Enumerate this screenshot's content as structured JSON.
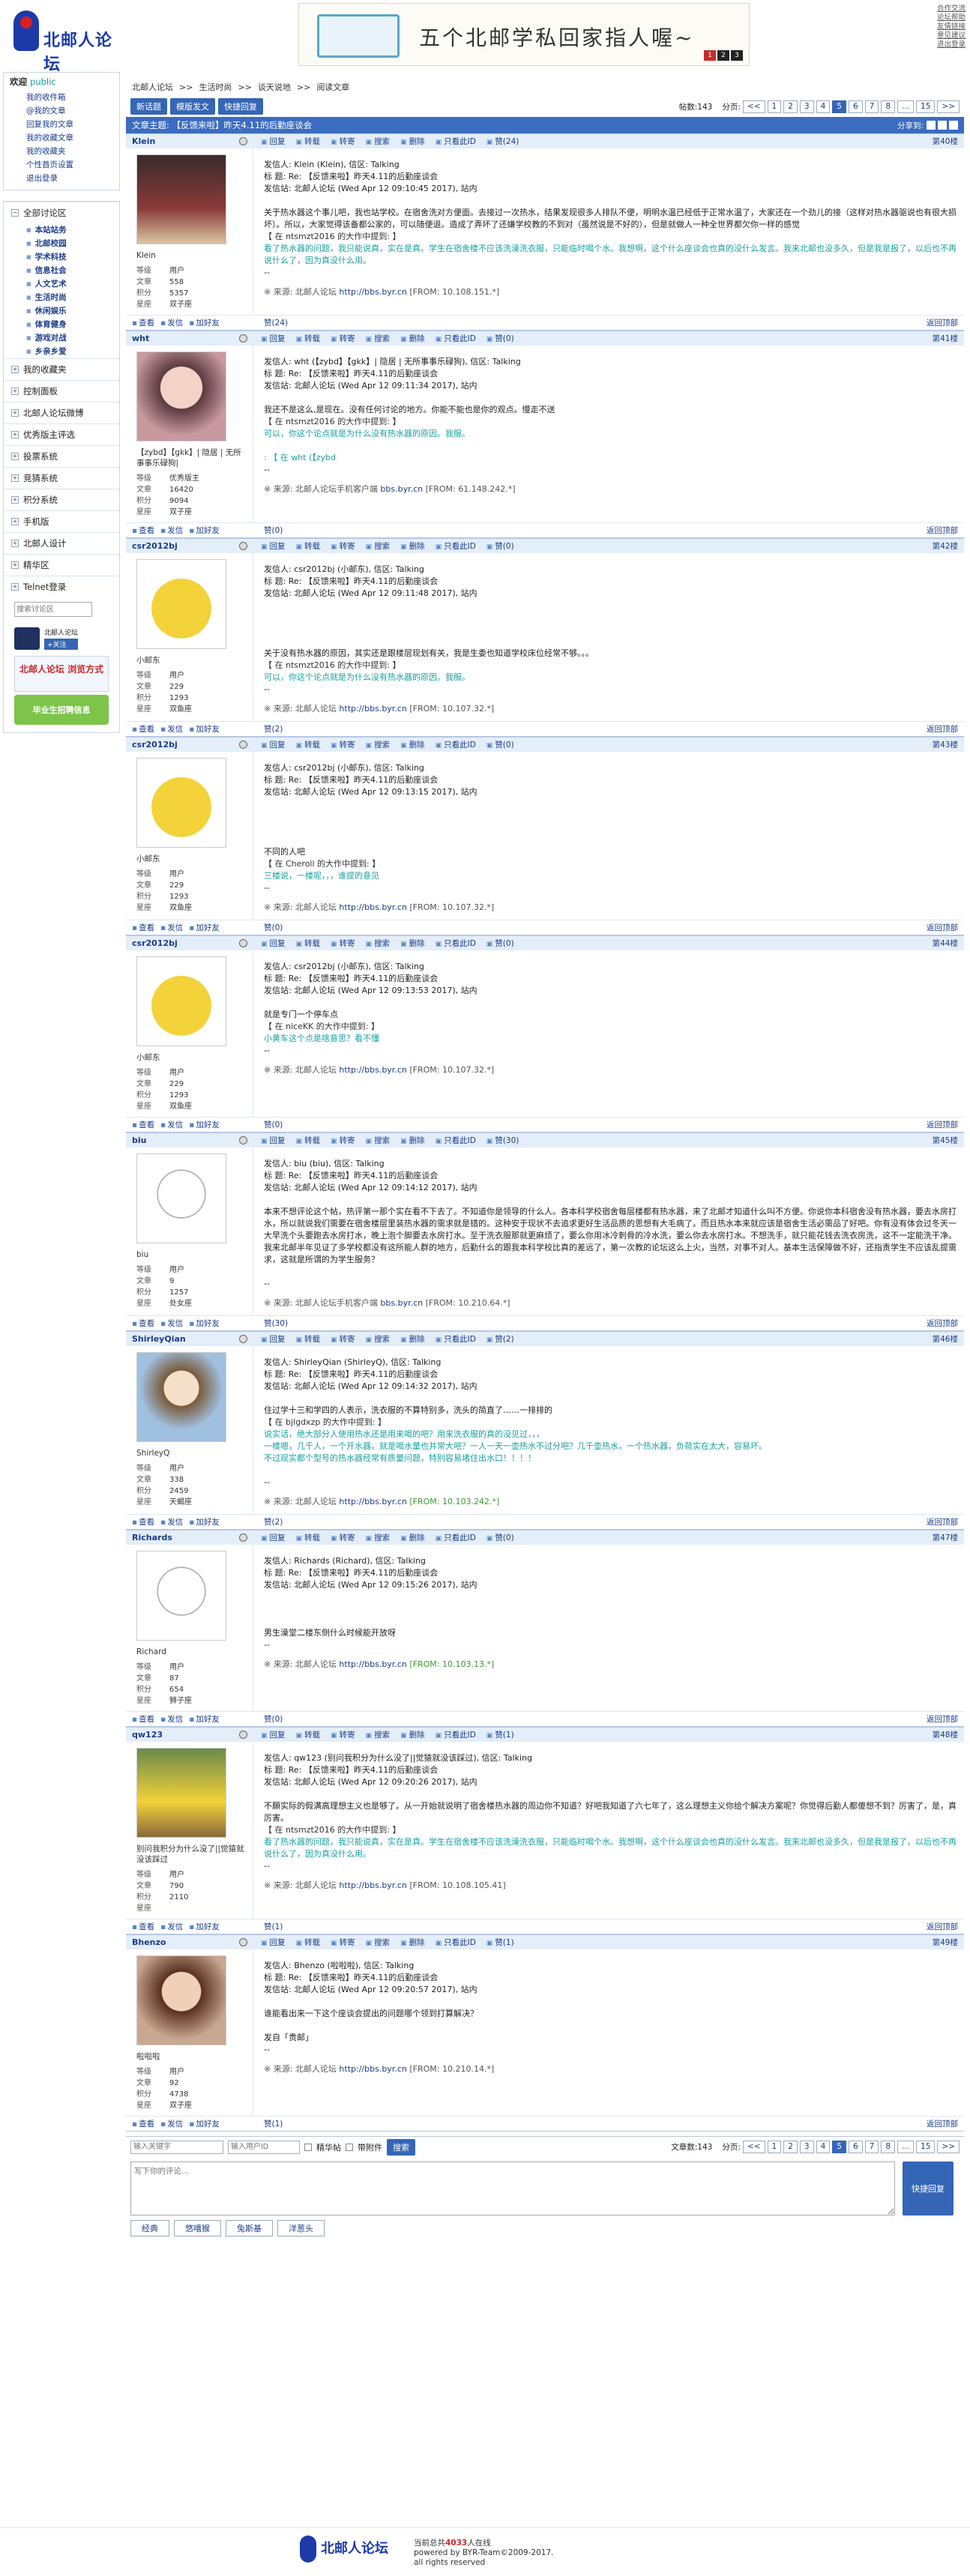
{
  "header": {
    "logo": "北邮人论坛",
    "banner_text": "五个北邮学私回家指人喔~",
    "banner_pages": [
      "1",
      "2",
      "3"
    ],
    "links": [
      "合作交流",
      "论坛帮助",
      "友情链接",
      "意见建议",
      "退出登录"
    ]
  },
  "sidebar": {
    "welcome": "欢迎",
    "pub": "public",
    "my": [
      "我的收件箱",
      "@我的文章",
      "回复我的文章",
      "我的收藏文章",
      "我的收藏夹",
      "个性首页设置",
      "退出登录"
    ],
    "all": "全部讨论区",
    "boards": [
      "本站站务",
      "北邮校园",
      "学术科技",
      "信息社会",
      "人文艺术",
      "生活时尚",
      "休闲娱乐",
      "体育健身",
      "游戏对战",
      "乡亲乡爱"
    ],
    "sections": [
      "我的收藏夹",
      "控制面板",
      "北邮人论坛微博",
      "优秀版主评选",
      "投票系统",
      "竞猜系统",
      "积分系统",
      "手机版",
      "北邮人设计",
      "精华区",
      "Telnet登录"
    ],
    "search_placeholder": "搜索讨论区",
    "weibo": "北邮人论坛",
    "follow": "+关注",
    "promo1": "北邮人论坛 浏览方式",
    "promo2": "毕业生招聘信息"
  },
  "crumb": [
    "北邮人论坛",
    ">>",
    "生活时尚",
    ">>",
    "谈天说地",
    ">>",
    "阅读文章"
  ],
  "toolbar": {
    "new": "新话题",
    "template": "模版发文",
    "reply": "快捷回复",
    "count": "帖数:143",
    "pages_label": "分页:",
    "pages": [
      "<<",
      "1",
      "2",
      "3",
      "4",
      "5",
      "6",
      "7",
      "8",
      "...",
      "15",
      ">>"
    ],
    "cur": "5"
  },
  "topic": {
    "label": "文章主题:",
    "title": "【反馈来啦】昨天4.11的后勤座谈会",
    "share": "分享到:"
  },
  "actions": [
    "回复",
    "转载",
    "转寄",
    "搜索",
    "删除",
    "只看此ID"
  ],
  "foot_actions": [
    "查看",
    "发信",
    "加好友"
  ],
  "back_top": "返回顶部",
  "stat_labels": [
    "等级",
    "文章",
    "积分",
    "星座"
  ],
  "posts": [
    {
      "id": "Klein",
      "floor": "第40楼",
      "like_head": "赞(24)",
      "like_foot": "赞(24)",
      "nick": "Klein",
      "lvl": "用户",
      "posts": "558",
      "score": "5357",
      "star": "双子座",
      "lines": [
        "发信人: Klein (Klein), 信区: Talking",
        "标  题: Re: 【反馈来啦】昨天4.11的后勤座谈会",
        "发信站: 北邮人论坛 (Wed Apr 12 09:10:45 2017), 站内",
        "",
        "关于热水器这个事儿吧，我也站学校。在宿舍洗对方便面。去接过一次热水，结果发现很多人排队不便，明明水温已经低于正常水温了，大家还在一个劲儿的接（这样对热水器驱说也有很大损坏）。所以，大家觉得该备都公家的，可以随便退。造成了弄坏了还嫌学校教的不到对（虽然说是不好的），但是就做人一种全世界都欠你一样的感觉",
        "【 在 ntsmzt2016 的大作中提到: 】"
      ],
      "quote": [
        " 看了热水器的问题，我只能说真，实在是真。学生在宿舍楼不应该洗澡洗衣服，只能临时喝个水。我想啊，这个什么座谈会也真的没什么发言。我来北邮也没多久，但是我是报了，以后也不再说什么了，因为真没什么用。"
      ],
      "src_pre": "※ 来源: 北邮人论坛 ",
      "src_link": "http://bbs.byr.cn",
      "src_ip": " [FROM: 10.108.151.*]",
      "gr": false
    },
    {
      "id": "wht",
      "floor": "第41楼",
      "like_head": "赞(0)",
      "like_foot": "赞(0)",
      "nick": "【zybd】【gkk】| 隐居 | 无所事事乐碌狗|",
      "lvl": "优秀版主",
      "posts": "16420",
      "score": "9094",
      "star": "双子座",
      "lines": [
        "发信人: wht (【zybd】【gkk】| 隐居 | 无所事事乐碌狗), 信区: Talking",
        "标  题: Re: 【反馈来啦】昨天4.11的后勤座谈会",
        "发信站: 北邮人论坛 (Wed Apr 12 09:11:34 2017), 站内",
        "",
        "我还不是这么,是现在。没有任何讨论的地方。你能不能也是你的观点。慢走不送",
        "【 在 ntsmzt2016 的大作中提到: 】"
      ],
      "quote": [
        " 可以，你这个论点就是为什么没有热水器的原因。我服。",
        "",
        ": 【 在 wht (【zybd"
      ],
      "src_pre": "※ 来源: 北邮人论坛手机客户端 ",
      "src_link": "bbs.byr.cn",
      "src_ip": " [FROM: 61.148.242.*]",
      "gr": false
    },
    {
      "id": "csr2012bj",
      "floor": "第42楼",
      "like_head": "赞(0)",
      "like_foot": "赞(2)",
      "nick": "小邮东",
      "lvl": "用户",
      "posts": "229",
      "score": "1293",
      "star": "双鱼座",
      "lines": [
        "发信人: csr2012bj (小邮东), 信区: Talking",
        "标  题: Re: 【反馈来啦】昨天4.11的后勤座谈会",
        "发信站: 北邮人论坛 (Wed Apr 12 09:11:48 2017), 站内",
        "",
        "",
        "",
        "",
        "关于没有热水器的原因，其实还是跟楼层现划有关，我是生委也知道学校床位经常不够。。。",
        "【 在 ntsmzt2016 的大作中提到: 】"
      ],
      "quote": [
        " 可以，你这个论点就是为什么没有热水器的原因。我服。"
      ],
      "src_pre": "※ 来源: 北邮人论坛 ",
      "src_link": "http://bbs.byr.cn",
      "src_ip": " [FROM: 10.107.32.*]",
      "gr": false
    },
    {
      "id": "csr2012bj",
      "floor": "第43楼",
      "like_head": "赞(0)",
      "like_foot": "赞(0)",
      "nick": "小邮东",
      "lvl": "用户",
      "posts": "229",
      "score": "1293",
      "star": "双鱼座",
      "lines": [
        "发信人: csr2012bj (小邮东), 信区: Talking",
        "标  题: Re: 【反馈来啦】昨天4.11的后勤座谈会",
        "发信站: 北邮人论坛 (Wed Apr 12 09:13:15 2017), 站内",
        "",
        "",
        "",
        "",
        "不同的人吧",
        "【 在 Cheroll 的大作中提到: 】"
      ],
      "quote": [
        " 三楼说，一楼呢，，，谁提的意见"
      ],
      "src_pre": "※ 来源: 北邮人论坛 ",
      "src_link": "http://bbs.byr.cn",
      "src_ip": " [FROM: 10.107.32.*]",
      "gr": false
    },
    {
      "id": "csr2012bj",
      "floor": "第44楼",
      "like_head": "赞(0)",
      "like_foot": "赞(0)",
      "nick": "小邮东",
      "lvl": "用户",
      "posts": "229",
      "score": "1293",
      "star": "双鱼座",
      "lines": [
        "发信人: csr2012bj (小邮东), 信区: Talking",
        "标  题: Re: 【反馈来啦】昨天4.11的后勤座谈会",
        "发信站: 北邮人论坛 (Wed Apr 12 09:13:53 2017), 站内",
        "",
        "就是专门一个停车点",
        "【 在 niceKK 的大作中提到: 】"
      ],
      "quote": [
        " 小黄车这个点是啥意思？看不懂"
      ],
      "src_pre": "※ 来源: 北邮人论坛 ",
      "src_link": "http://bbs.byr.cn",
      "src_ip": " [FROM: 10.107.32.*]",
      "gr": false
    },
    {
      "id": "biu",
      "floor": "第45楼",
      "like_head": "赞(30)",
      "like_foot": "赞(30)",
      "nick": "biu",
      "lvl": "用户",
      "posts": "9",
      "score": "1257",
      "star": "处女座",
      "lines": [
        "发信人: biu (biu), 信区: Talking",
        "标  题: Re: 【反馈来啦】昨天4.11的后勤座谈会",
        "发信站: 北邮人论坛 (Wed Apr 12 09:14:12 2017), 站内",
        "",
        "本来不想评论这个帖，热评第一那个实在看不下去了。不知道你是领导的什么人。各本科学校宿舍每层楼都有热水器，来了北邮才知道什么叫不方便。你说你本科宿舍没有热水器，要去水房打水，所以就说我们需要在宿舍楼层里装热水器的需求就是错的。这种安于现状不去追求更好生活品质的思想有大毛病了。而且热水本来就应该是宿舍生活必需品了好吧。你有没有体会过冬天一大早洗个头要跑去水房打水，晚上泡个脚要去水房打水。至于洗衣服那就更麻烦了，要么你用冰冷刺骨的冷水洗，要么你去水房打水。不想洗手，就只能花钱去洗衣房洗，这不一定能洗干净。我来北邮半年见证了多学校都没有这所能人群的地方，后勤什么的跟我本科学校比真的差远了，第一次教的论坛这么上火，当然，对事不对人。基本生活保障做不好，还指责学生不应该乱提需求，这就是所谓的为学生服务？",
        ""
      ],
      "quote": [],
      "src_pre": "※ 来源: 北邮人论坛手机客户端 ",
      "src_link": "bbs.byr.cn",
      "src_ip": " [FROM: 10.210.64.*]",
      "gr": false
    },
    {
      "id": "ShirleyQian",
      "floor": "第46楼",
      "like_head": "赞(2)",
      "like_foot": "赞(2)",
      "nick": "ShirleyQ",
      "lvl": "用户",
      "posts": "338",
      "score": "2459",
      "star": "天蝎座",
      "lines": [
        "发信人: ShirleyQian (ShirleyQ), 信区: Talking",
        "标  题: Re: 【反馈来啦】昨天4.11的后勤座谈会",
        "发信站: 北邮人论坛 (Wed Apr 12 09:14:32 2017), 站内",
        "",
        "住过学十三和学四的人表示，洗衣服的不算特别多，洗头的简直了……一排排的",
        "【 在 bjlgdxzp 的大作中提到: 】"
      ],
      "quote": [
        " 说实话，绝大部分人使用热水还是用来喝的吧？用来洗衣服的真的没见过，，，",
        " 一楼嗯，几千人，一个开水器，就是喝水量也并常大吧？一人一天一壶热水不过分吧？几千壶热水，一个热水器，负荷实在太大，容易坏。",
        " 不过现实都个型号的热水器经常有质量问题，特别容易堵住出水口！！！！",
        ""
      ],
      "src_pre": "※ 来源: 北邮人论坛 ",
      "src_link": "http://bbs.byr.cn",
      "src_ip": " [FROM: 10.103.242.*]",
      "gr": true
    },
    {
      "id": "Richards",
      "floor": "第47楼",
      "like_head": "赞(0)",
      "like_foot": "赞(0)",
      "nick": "Richard",
      "lvl": "用户",
      "posts": "87",
      "score": "654",
      "star": "狮子座",
      "lines": [
        "发信人: Richards (Richard), 信区: Talking",
        "标  题: Re: 【反馈来啦】昨天4.11的后勤座谈会",
        "发信站: 北邮人论坛 (Wed Apr 12 09:15:26 2017), 站内",
        "",
        "",
        "",
        "男生澡堂二楼东侧什么时候能开放呀"
      ],
      "quote": [],
      "src_pre": "※ 来源: 北邮人论坛 ",
      "src_link": "http://bbs.byr.cn",
      "src_ip": " [FROM: 10.103.13.*]",
      "gr": true
    },
    {
      "id": "qw123",
      "floor": "第48楼",
      "like_head": "赞(1)",
      "like_foot": "赞(1)",
      "nick": "别问我积分为什么没了||觉猿就没该踩过",
      "lvl": "用户",
      "posts": "790",
      "score": "2110",
      "star": "",
      "lines": [
        "发信人: qw123 (别问我积分为什么没了||觉猿就没该踩过), 信区: Talking",
        "标  题: Re: 【反馈来啦】昨天4.11的后勤座谈会",
        "发信站: 北邮人论坛 (Wed Apr 12 09:20:26 2017), 站内",
        "",
        "不願实际的假满高理想主义也是够了。从一开始就说明了宿舍楼热水器的周边你不知道？好吧我知道了六七年了，这么理想主义你给个解决方案呢？你觉得后勤人都傻想不到？厉害了，是，真厉害。",
        "【 在 ntsmzt2016 的大作中提到: 】"
      ],
      "quote": [
        " 看了热水器的问题，我只能说真，实在是真。学生在宿舍楼不应该洗澡洗衣服，只能临时喝个水。我想啊，这个什么座谈会也真的没什么发言。我来北邮也没多久，但是我是报了，以后也不再说什么了，因为真没什么用。"
      ],
      "src_pre": "※ 来源: 北邮人论坛 ",
      "src_link": "http://bbs.byr.cn",
      "src_ip": " [FROM: 10.108.105.41]",
      "gr": false
    },
    {
      "id": "Bhenzo",
      "floor": "第49楼",
      "like_head": "赞(1)",
      "like_foot": "赞(1)",
      "nick": "啦啦啦",
      "lvl": "用户",
      "posts": "92",
      "score": "4738",
      "star": "双子座",
      "lines": [
        "发信人: Bhenzo (啦啦啦), 信区: Talking",
        "标  题: Re: 【反馈来啦】昨天4.11的后勤座谈会",
        "发信站: 北邮人论坛 (Wed Apr 12 09:20:57 2017), 站内",
        "",
        "谁能看出来一下这个座谈会提出的问题哪个领到打算解决？",
        "",
        "发自「贵邮」"
      ],
      "quote": [],
      "src_pre": "※ 来源: 北邮人论坛 ",
      "src_link": "http://bbs.byr.cn",
      "src_ip": " [FROM: 10.210.14.*]",
      "gr": false
    }
  ],
  "bottom": {
    "search_ph": "输入关键字",
    "user_ph": "输入用户ID",
    "cb1": "精华帖",
    "cb2": "带附件",
    "search": "搜索",
    "count": "文章数:143",
    "pages_label": "分页:"
  },
  "reply": {
    "placeholder": "写下你的评论...",
    "send": "快捷回复",
    "tabs": [
      "经典",
      "悠嘻猴",
      "兔斯基",
      "洋葱头"
    ]
  },
  "footer": {
    "logo": "北邮人论坛",
    "online_pre": "当前总共",
    "online": "4033",
    "online_suf": "人在线",
    "powered": "powered by BYR-Team©2009-2017.",
    "rights": "all rights reserved"
  }
}
